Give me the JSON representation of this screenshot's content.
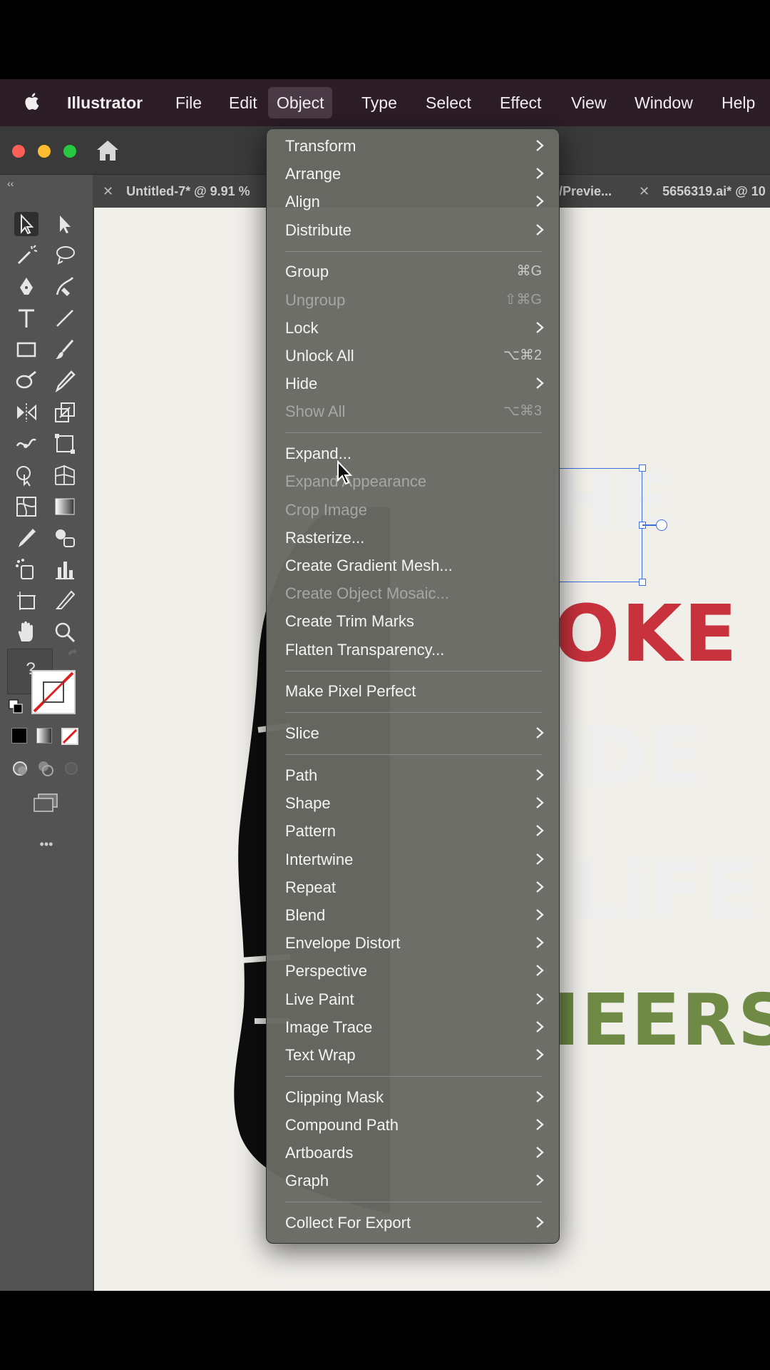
{
  "menubar": {
    "app_name": "Illustrator",
    "items": [
      "File",
      "Edit",
      "Object",
      "Type",
      "Select",
      "Effect",
      "View",
      "Window",
      "Help"
    ],
    "active": "Object"
  },
  "tabs": [
    {
      "label": "Untitled-7* @ 9.91 %"
    },
    {
      "label": "/Previe..."
    },
    {
      "label": "5656319.ai* @ 10"
    }
  ],
  "canvas_text": {
    "line1": "HE",
    "line2": "OKE",
    "line3": "iDE",
    "line4": "LiFE",
    "line5": "IEERS",
    "colors": {
      "red": "#c8323c",
      "dark": "#1c1418",
      "green": "#6e8a45"
    }
  },
  "toolbar": {
    "question_mark": "?",
    "more": "•••"
  },
  "object_menu": {
    "items": [
      {
        "label": "Transform",
        "submenu": true
      },
      {
        "label": "Arrange",
        "submenu": true
      },
      {
        "label": "Align",
        "submenu": true
      },
      {
        "label": "Distribute",
        "submenu": true
      },
      {
        "separator": true
      },
      {
        "label": "Group",
        "shortcut": "⌘G"
      },
      {
        "label": "Ungroup",
        "shortcut": "⇧⌘G",
        "disabled": true
      },
      {
        "label": "Lock",
        "submenu": true
      },
      {
        "label": "Unlock All",
        "shortcut": "⌥⌘2"
      },
      {
        "label": "Hide",
        "submenu": true
      },
      {
        "label": "Show All",
        "shortcut": "⌥⌘3",
        "disabled": true
      },
      {
        "separator": true
      },
      {
        "label": "Expand..."
      },
      {
        "label": "Expand Appearance",
        "disabled": true
      },
      {
        "label": "Crop Image",
        "disabled": true
      },
      {
        "label": "Rasterize..."
      },
      {
        "label": "Create Gradient Mesh..."
      },
      {
        "label": "Create Object Mosaic...",
        "disabled": true
      },
      {
        "label": "Create Trim Marks"
      },
      {
        "label": "Flatten Transparency..."
      },
      {
        "separator": true
      },
      {
        "label": "Make Pixel Perfect"
      },
      {
        "separator": true
      },
      {
        "label": "Slice",
        "submenu": true
      },
      {
        "separator": true
      },
      {
        "label": "Path",
        "submenu": true
      },
      {
        "label": "Shape",
        "submenu": true
      },
      {
        "label": "Pattern",
        "submenu": true
      },
      {
        "label": "Intertwine",
        "submenu": true
      },
      {
        "label": "Repeat",
        "submenu": true
      },
      {
        "label": "Blend",
        "submenu": true
      },
      {
        "label": "Envelope Distort",
        "submenu": true
      },
      {
        "label": "Perspective",
        "submenu": true
      },
      {
        "label": "Live Paint",
        "submenu": true
      },
      {
        "label": "Image Trace",
        "submenu": true
      },
      {
        "label": "Text Wrap",
        "submenu": true
      },
      {
        "separator": true
      },
      {
        "label": "Clipping Mask",
        "submenu": true
      },
      {
        "label": "Compound Path",
        "submenu": true
      },
      {
        "label": "Artboards",
        "submenu": true
      },
      {
        "label": "Graph",
        "submenu": true
      },
      {
        "separator": true
      },
      {
        "label": "Collect For Export",
        "submenu": true
      }
    ]
  }
}
